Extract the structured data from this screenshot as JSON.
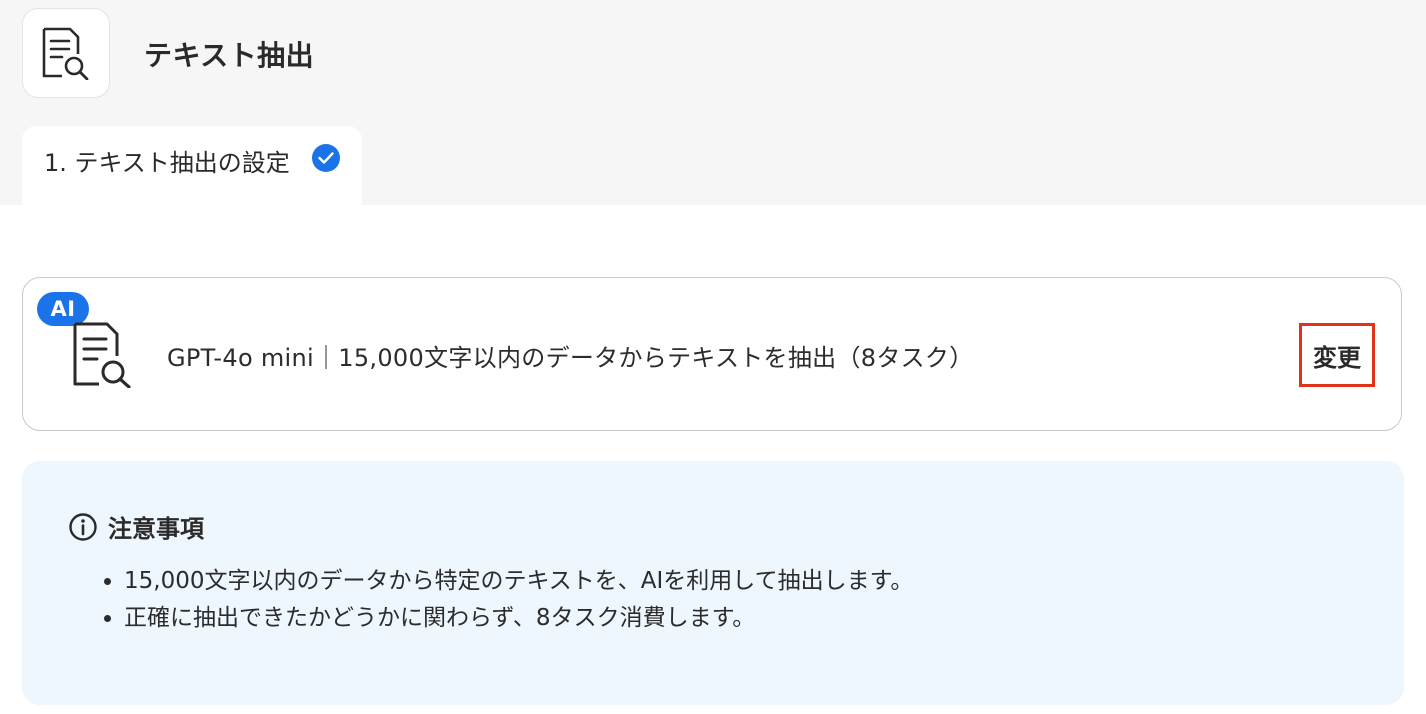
{
  "header": {
    "title": "テキスト抽出",
    "icon": "document-search-icon"
  },
  "steps": [
    {
      "label": "1. テキスト抽出の設定",
      "status": "complete"
    }
  ],
  "model_card": {
    "badge": "AI",
    "icon": "document-search-icon",
    "description": "GPT-4o mini｜15,000文字以内のデータからテキストを抽出（8タスク）",
    "change_label": "変更"
  },
  "notice": {
    "icon": "info-icon",
    "title": "注意事項",
    "items": [
      "15,000文字以内のデータから特定のテキストを、AIを利用して抽出します。",
      "正確に抽出できたかどうかに関わらず、8タスク消費します。"
    ]
  },
  "colors": {
    "accent": "#1a73e8",
    "highlight_border": "#e0341a",
    "notice_bg": "#eef6fe",
    "top_band": "#f6f6f6"
  }
}
